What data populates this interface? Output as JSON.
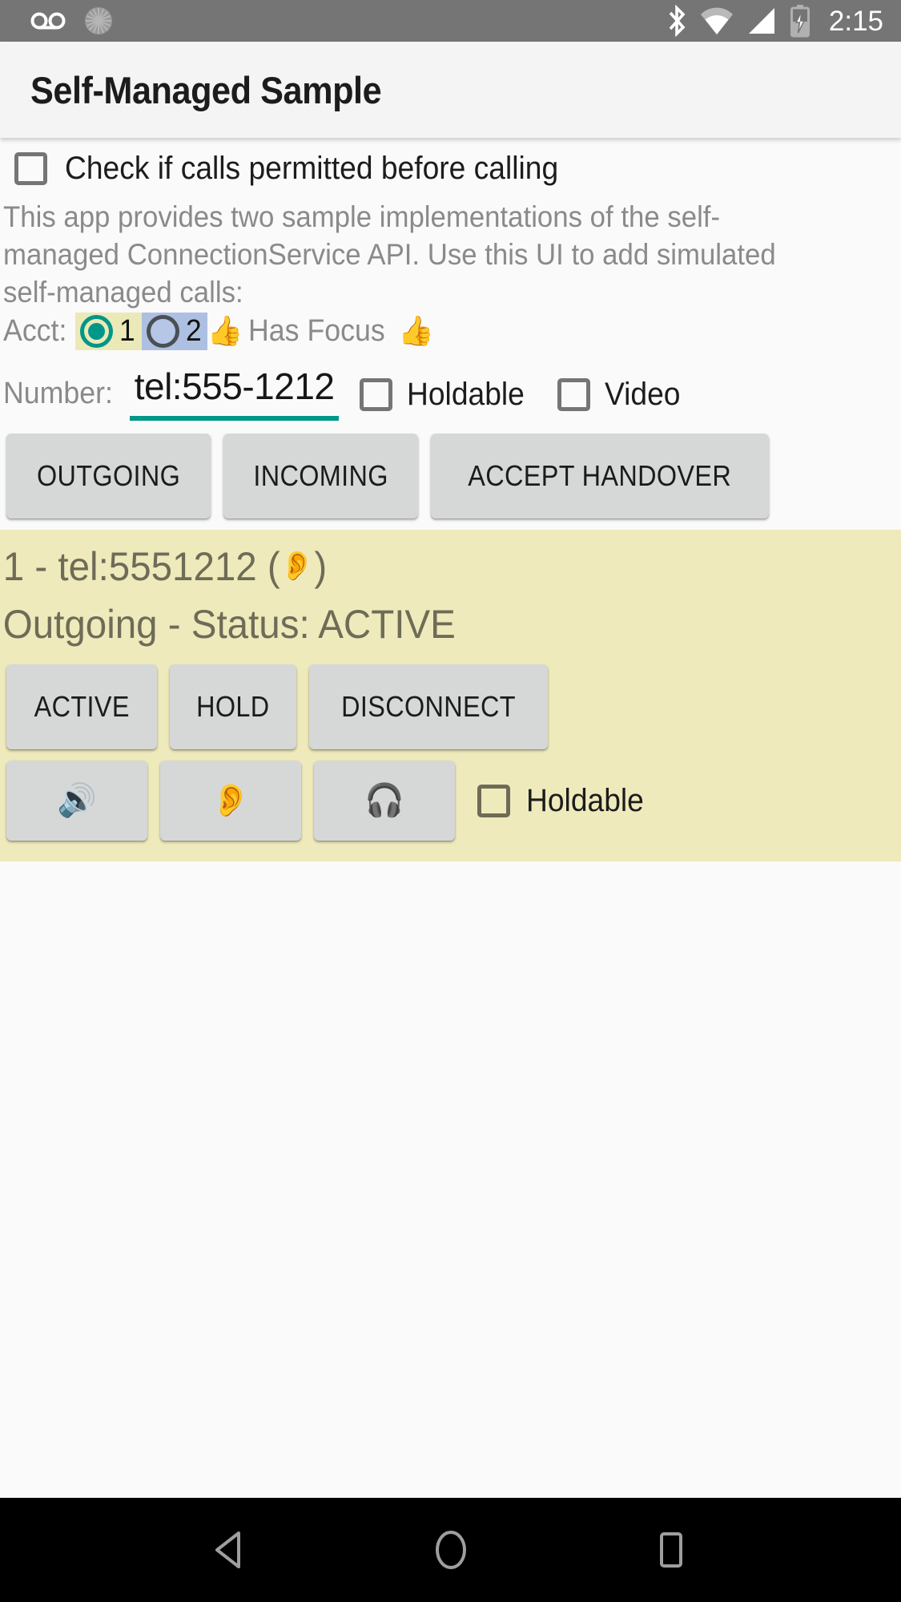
{
  "status_bar": {
    "left_icons": [
      "voicemail-icon",
      "sync-icon"
    ],
    "right_icons": [
      "bluetooth-icon",
      "wifi-icon",
      "cell-signal-icon",
      "battery-charging-icon"
    ],
    "clock": "2:15",
    "background": "#757575"
  },
  "app_bar": {
    "title": "Self-Managed Sample",
    "background": "#f4f4f4"
  },
  "permission": {
    "checkbox_label": "Check if calls permitted before calling",
    "checked": false
  },
  "description": "This app provides two sample implementations of the self-managed ConnectionService API.  Use this UI to add simulated self-managed calls:",
  "account": {
    "label": "Acct:",
    "options": [
      {
        "value": "1",
        "selected": true,
        "highlight": "#ece9b8"
      },
      {
        "value": "2",
        "selected": false,
        "highlight": "#adc0e2"
      }
    ],
    "focus_emoji_left": "👍",
    "focus_text": "Has Focus",
    "focus_emoji_right": "👍",
    "accent": "#009688"
  },
  "number": {
    "label": "Number:",
    "value": "tel:555-1212",
    "placeholder": "tel:555-1212",
    "holdable_label": "Holdable",
    "holdable_checked": false,
    "video_label": "Video",
    "video_checked": false,
    "underline_color": "#009688"
  },
  "actions": [
    {
      "label": "OUTGOING",
      "name": "outgoing-button"
    },
    {
      "label": "INCOMING",
      "name": "incoming-button"
    },
    {
      "label": "ACCEPT HANDOVER",
      "name": "accept-handover-button"
    }
  ],
  "call_card": {
    "background": "#eeeabb",
    "text_color": "#6e6c57",
    "line1_prefix": "1 - tel:5551212 ( ",
    "line1_emoji": "👂",
    "line1_suffix": " )",
    "line2": "Outgoing - Status: ACTIVE",
    "state_buttons": [
      {
        "label": "ACTIVE",
        "name": "call-active-button"
      },
      {
        "label": "HOLD",
        "name": "call-hold-button"
      },
      {
        "label": "DISCONNECT",
        "name": "call-disconnect-button"
      }
    ],
    "audio_buttons": [
      {
        "emoji": "🔊",
        "name": "audio-route-speaker-button"
      },
      {
        "emoji": "👂",
        "name": "audio-route-earpiece-button"
      },
      {
        "emoji": "🎧",
        "name": "audio-route-headset-button"
      }
    ],
    "holdable_label": "Holdable",
    "holdable_checked": false
  },
  "nav_bar": {
    "back": "back-nav-button",
    "home": "home-nav-button",
    "recents": "recents-nav-button"
  }
}
